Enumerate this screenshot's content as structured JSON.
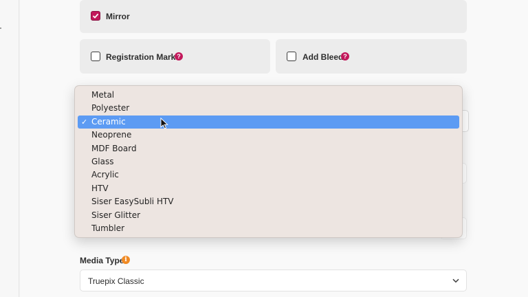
{
  "options": {
    "mirror": {
      "label": "Mirror",
      "checked": true
    },
    "registration_marks": {
      "label": "Registration Marks",
      "checked": false,
      "help_icon": "?"
    },
    "add_bleed": {
      "label": "Add Bleed",
      "checked": false,
      "help_icon": "?"
    }
  },
  "material_dropdown": {
    "items": [
      "Metal",
      "Polyester",
      "Ceramic",
      "Neoprene",
      "MDF Board",
      "Glass",
      "Acrylic",
      "HTV",
      "Siser EasySubli HTV",
      "Siser Glitter",
      "Tumbler"
    ],
    "selected": "Ceramic",
    "check_mark": "✓"
  },
  "media_type": {
    "label": "Media Type",
    "info_icon": "i",
    "value": "Truepix Classic"
  },
  "colors": {
    "accent": "#c2185b",
    "info": "#f08a24",
    "selection": "#5c9bf3"
  }
}
